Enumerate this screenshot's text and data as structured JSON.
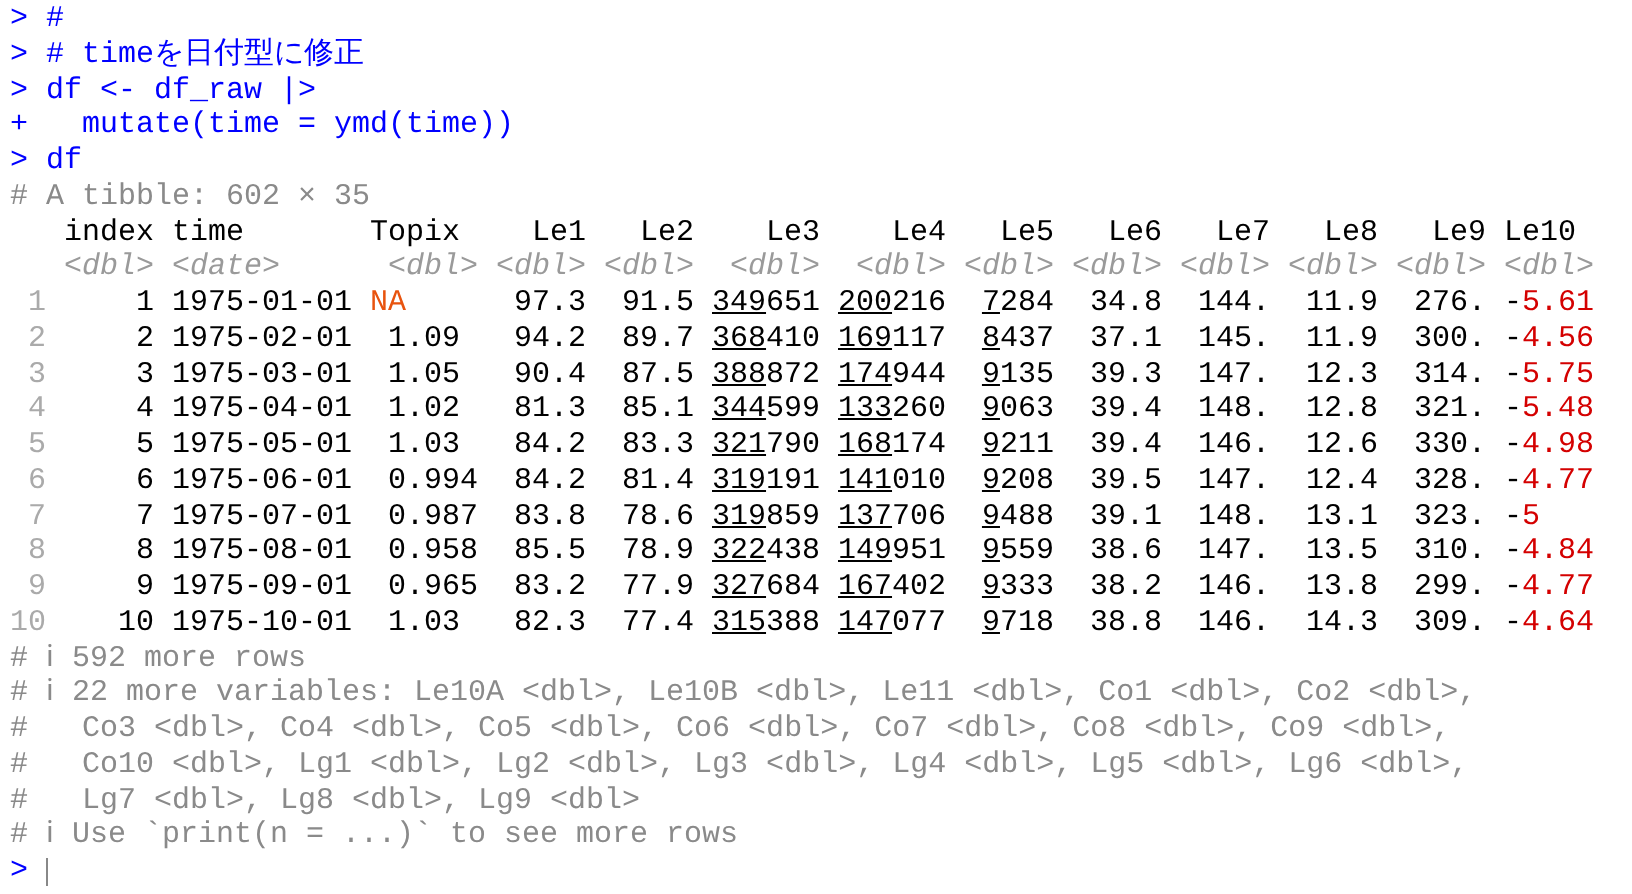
{
  "console": {
    "inputs": [
      {
        "prompt": ">",
        "code": "#"
      },
      {
        "prompt": ">",
        "code": "# timeを日付型に修正"
      },
      {
        "prompt": ">",
        "code": "df <- df_raw |>"
      },
      {
        "prompt": "+",
        "code": "  mutate(time = ymd(time))"
      },
      {
        "prompt": ">",
        "code": "df"
      }
    ],
    "tibble": {
      "header": "# A tibble: 602 × 35",
      "columns": [
        {
          "name": "index",
          "type": "<dbl>"
        },
        {
          "name": "time",
          "type": "<date>"
        },
        {
          "name": "Topix",
          "type": "<dbl>"
        },
        {
          "name": "Le1",
          "type": "<dbl>"
        },
        {
          "name": "Le2",
          "type": "<dbl>"
        },
        {
          "name": "Le3",
          "type": "<dbl>"
        },
        {
          "name": "Le4",
          "type": "<dbl>"
        },
        {
          "name": "Le5",
          "type": "<dbl>"
        },
        {
          "name": "Le6",
          "type": "<dbl>"
        },
        {
          "name": "Le7",
          "type": "<dbl>"
        },
        {
          "name": "Le8",
          "type": "<dbl>"
        },
        {
          "name": "Le9",
          "type": "<dbl>"
        },
        {
          "name": "Le10",
          "type": "<dbl>"
        }
      ],
      "rows": [
        {
          "row_number": "1",
          "cells": [
            "1",
            "1975-01-01",
            {
              "kind": "na",
              "text": "NA"
            },
            "97.3",
            "91.5",
            {
              "kind": "grouped",
              "lead": "349",
              "rest": "651"
            },
            {
              "kind": "grouped",
              "lead": "200",
              "rest": "216"
            },
            {
              "kind": "grouped",
              "lead": "7",
              "rest": "284"
            },
            "34.8",
            "144.",
            "11.9",
            "276.",
            {
              "kind": "negative",
              "sign": "-",
              "digits": "5.61"
            }
          ]
        },
        {
          "row_number": "2",
          "cells": [
            "2",
            "1975-02-01",
            "1.09",
            "94.2",
            "89.7",
            {
              "kind": "grouped",
              "lead": "368",
              "rest": "410"
            },
            {
              "kind": "grouped",
              "lead": "169",
              "rest": "117"
            },
            {
              "kind": "grouped",
              "lead": "8",
              "rest": "437"
            },
            "37.1",
            "145.",
            "11.9",
            "300.",
            {
              "kind": "negative",
              "sign": "-",
              "digits": "4.56"
            }
          ]
        },
        {
          "row_number": "3",
          "cells": [
            "3",
            "1975-03-01",
            "1.05",
            "90.4",
            "87.5",
            {
              "kind": "grouped",
              "lead": "388",
              "rest": "872"
            },
            {
              "kind": "grouped",
              "lead": "174",
              "rest": "944"
            },
            {
              "kind": "grouped",
              "lead": "9",
              "rest": "135"
            },
            "39.3",
            "147.",
            "12.3",
            "314.",
            {
              "kind": "negative",
              "sign": "-",
              "digits": "5.75"
            }
          ]
        },
        {
          "row_number": "4",
          "cells": [
            "4",
            "1975-04-01",
            "1.02",
            "81.3",
            "85.1",
            {
              "kind": "grouped",
              "lead": "344",
              "rest": "599"
            },
            {
              "kind": "grouped",
              "lead": "133",
              "rest": "260"
            },
            {
              "kind": "grouped",
              "lead": "9",
              "rest": "063"
            },
            "39.4",
            "148.",
            "12.8",
            "321.",
            {
              "kind": "negative",
              "sign": "-",
              "digits": "5.48"
            }
          ]
        },
        {
          "row_number": "5",
          "cells": [
            "5",
            "1975-05-01",
            "1.03",
            "84.2",
            "83.3",
            {
              "kind": "grouped",
              "lead": "321",
              "rest": "790"
            },
            {
              "kind": "grouped",
              "lead": "168",
              "rest": "174"
            },
            {
              "kind": "grouped",
              "lead": "9",
              "rest": "211"
            },
            "39.4",
            "146.",
            "12.6",
            "330.",
            {
              "kind": "negative",
              "sign": "-",
              "digits": "4.98"
            }
          ]
        },
        {
          "row_number": "6",
          "cells": [
            "6",
            "1975-06-01",
            "0.994",
            "84.2",
            "81.4",
            {
              "kind": "grouped",
              "lead": "319",
              "rest": "191"
            },
            {
              "kind": "grouped",
              "lead": "141",
              "rest": "010"
            },
            {
              "kind": "grouped",
              "lead": "9",
              "rest": "208"
            },
            "39.5",
            "147.",
            "12.4",
            "328.",
            {
              "kind": "negative",
              "sign": "-",
              "digits": "4.77"
            }
          ]
        },
        {
          "row_number": "7",
          "cells": [
            "7",
            "1975-07-01",
            "0.987",
            "83.8",
            "78.6",
            {
              "kind": "grouped",
              "lead": "319",
              "rest": "859"
            },
            {
              "kind": "grouped",
              "lead": "137",
              "rest": "706"
            },
            {
              "kind": "grouped",
              "lead": "9",
              "rest": "488"
            },
            "39.1",
            "148.",
            "13.1",
            "323.",
            {
              "kind": "negative",
              "sign": "-",
              "digits": "5"
            }
          ]
        },
        {
          "row_number": "8",
          "cells": [
            "8",
            "1975-08-01",
            "0.958",
            "85.5",
            "78.9",
            {
              "kind": "grouped",
              "lead": "322",
              "rest": "438"
            },
            {
              "kind": "grouped",
              "lead": "149",
              "rest": "951"
            },
            {
              "kind": "grouped",
              "lead": "9",
              "rest": "559"
            },
            "38.6",
            "147.",
            "13.5",
            "310.",
            {
              "kind": "negative",
              "sign": "-",
              "digits": "4.84"
            }
          ]
        },
        {
          "row_number": "9",
          "cells": [
            "9",
            "1975-09-01",
            "0.965",
            "83.2",
            "77.9",
            {
              "kind": "grouped",
              "lead": "327",
              "rest": "684"
            },
            {
              "kind": "grouped",
              "lead": "167",
              "rest": "402"
            },
            {
              "kind": "grouped",
              "lead": "9",
              "rest": "333"
            },
            "38.2",
            "146.",
            "13.8",
            "299.",
            {
              "kind": "negative",
              "sign": "-",
              "digits": "4.77"
            }
          ]
        },
        {
          "row_number": "10",
          "cells": [
            "10",
            "1975-10-01",
            "1.03",
            "82.3",
            "77.4",
            {
              "kind": "grouped",
              "lead": "315",
              "rest": "388"
            },
            {
              "kind": "grouped",
              "lead": "147",
              "rest": "077"
            },
            {
              "kind": "grouped",
              "lead": "9",
              "rest": "718"
            },
            "38.8",
            "146.",
            "14.3",
            "309.",
            {
              "kind": "negative",
              "sign": "-",
              "digits": "4.64"
            }
          ]
        }
      ],
      "footer": [
        "# ℹ 592 more rows",
        "# ℹ 22 more variables: Le10A <dbl>, Le10B <dbl>, Le11 <dbl>, Co1 <dbl>, Co2 <dbl>,",
        "#   Co3 <dbl>, Co4 <dbl>, Co5 <dbl>, Co6 <dbl>, Co7 <dbl>, Co8 <dbl>, Co9 <dbl>,",
        "#   Co10 <dbl>, Lg1 <dbl>, Lg2 <dbl>, Lg3 <dbl>, Lg4 <dbl>, Lg5 <dbl>, Lg6 <dbl>,",
        "#   Lg7 <dbl>, Lg8 <dbl>, Lg9 <dbl>",
        "# ℹ Use `print(n = ...)` to see more rows"
      ]
    },
    "prompt": ">"
  }
}
